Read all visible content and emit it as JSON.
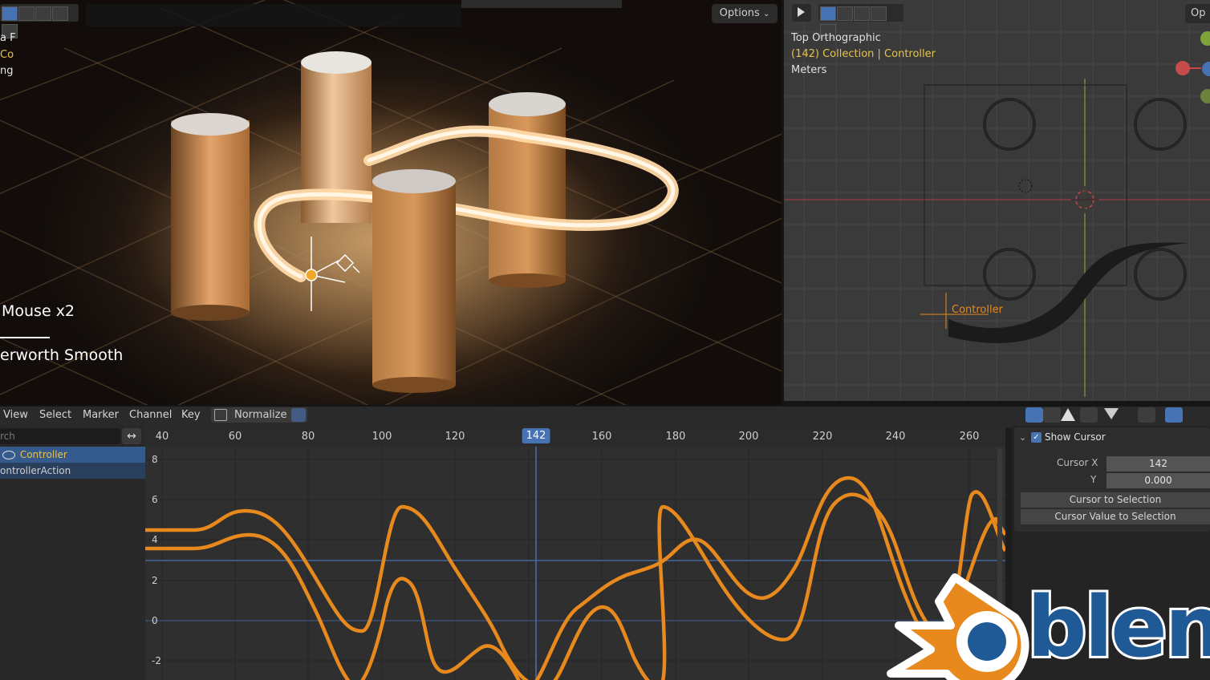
{
  "viewport3d": {
    "options_label": "Options",
    "left_cut_texts": [
      "a F",
      "Co",
      "ng"
    ],
    "overlay_line1": "Mouse x2",
    "overlay_line2": "erworth Smooth"
  },
  "ortho_view": {
    "view_name": "Top Orthographic",
    "collection_prefix": "(142) Collection",
    "collection_sep": " | ",
    "active_object": "Controller",
    "units": "Meters",
    "object_label": "Controller",
    "corner_label": "Op"
  },
  "graph_editor": {
    "menus": [
      "View",
      "Select",
      "Marker",
      "Channel",
      "Key"
    ],
    "normalize_label": "Normalize",
    "search_text": "rch",
    "channels": [
      {
        "label": "Controller",
        "selected": true
      },
      {
        "label": "ontrollerAction",
        "selected": false
      }
    ],
    "frame_ticks": [
      "40",
      "60",
      "80",
      "100",
      "120",
      "160",
      "180",
      "200",
      "220",
      "240",
      "260"
    ],
    "current_frame": "142",
    "y_ticks": [
      "8",
      "6",
      "4",
      "2",
      "0",
      "-2"
    ]
  },
  "side_panel": {
    "show_cursor_label": "Show Cursor",
    "cursor_x_label": "Cursor X",
    "cursor_x_value": "142",
    "cursor_y_label": "Y",
    "cursor_y_value": "0.000",
    "cursor_to_selection": "Cursor to Selection",
    "cursor_value_to_selection": "Cursor Value to Selection"
  },
  "logo": {
    "text": "blenc"
  },
  "colors": {
    "accent_blue": "#4772b3",
    "curve_orange": "#e8891e",
    "highlight_yellow": "#e8c24a"
  }
}
